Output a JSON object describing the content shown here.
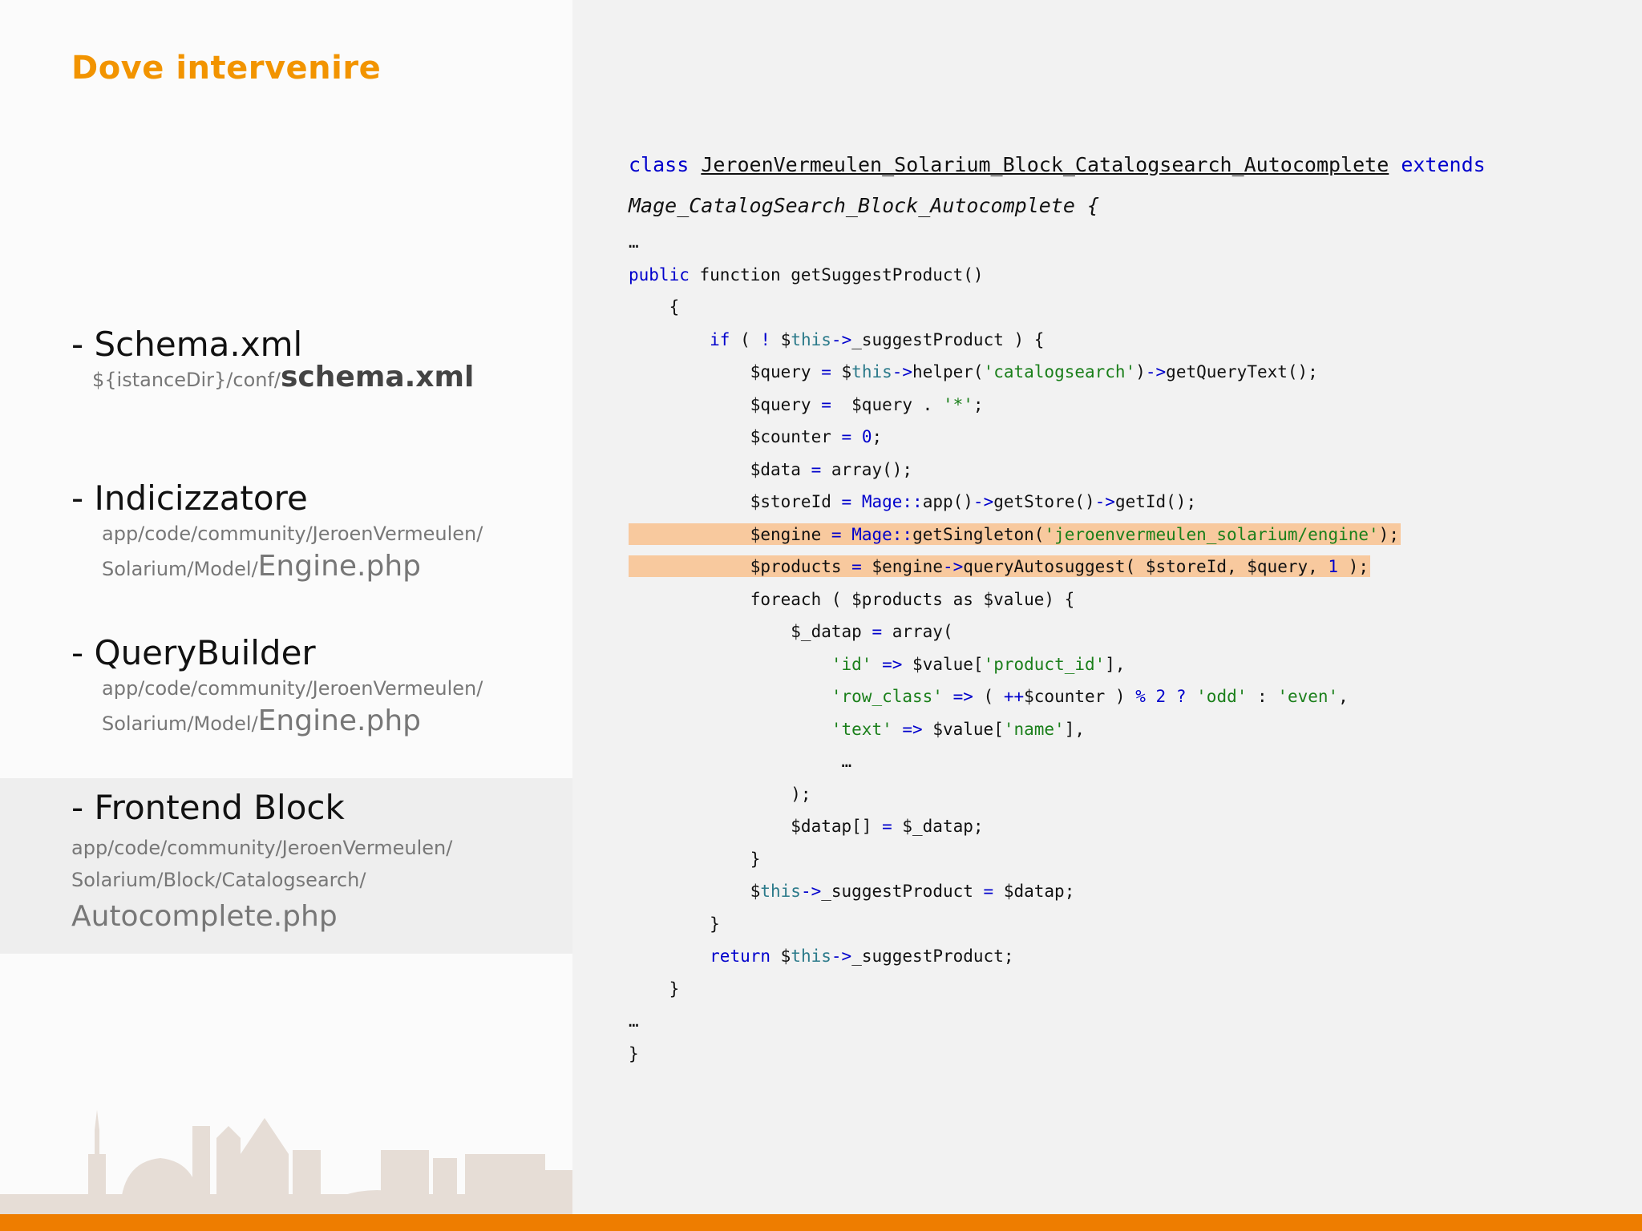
{
  "slide": {
    "title": "Dove intervenire",
    "items": [
      {
        "head": "- Schema.xml",
        "path_prefix": "${istanceDir}/conf/",
        "path_file": "schema.xml"
      },
      {
        "head": "- Indicizzatore",
        "path_line1": "app/code/community/JeroenVermeulen/",
        "path_line2_prefix": "Solarium/Model/",
        "path_file": "Engine.php"
      },
      {
        "head": "- QueryBuilder",
        "path_line1": "app/code/community/JeroenVermeulen/",
        "path_line2_prefix": "Solarium/Model/",
        "path_file": "Engine.php"
      },
      {
        "head": "- Frontend Block",
        "path_line1": "app/code/community/JeroenVermeulen/",
        "path_line2": "Solarium/Block/Catalogsearch/",
        "path_file": "Autocomplete.php"
      }
    ]
  },
  "code": {
    "class_kw": "class",
    "class_name": "JeroenVermeulen_Solarium_Block_Catalogsearch_Autocomplete",
    "extends_kw": "extends",
    "parent_class": "Mage_CatalogSearch_Block_Autocomplete {",
    "ellipsis": "…",
    "lines": [
      "public function getSuggestProduct()",
      "    {",
      "        if ( ! $this->_suggestProduct ) {",
      "            $query = $this->helper('catalogsearch')->getQueryText();",
      "            $query =  $query . '*';",
      "            $counter = 0;",
      "            $data = array();",
      "            $storeId = Mage::app()->getStore()->getId();",
      "            $engine = Mage::getSingleton('jeroenvermeulen_solarium/engine');",
      "            $products = $engine->queryAutosuggest( $storeId, $query, 1 );",
      "            foreach ( $products as $value) {",
      "                $_datap = array(",
      "                    'id' => $value['product_id'],",
      "                    'row_class' => ( ++$counter ) % 2 ? 'odd' : 'even',",
      "                    'text' => $value['name'],",
      "                     …",
      "                );",
      "                $datap[] = $_datap;",
      "            }",
      "            $this->_suggestProduct = $datap;",
      "        }",
      "        return $this->_suggestProduct;",
      "    }",
      "…",
      "}"
    ],
    "highlighted_lines": [
      8,
      9
    ],
    "colors": {
      "keyword": "#0000cc",
      "this": "#2b7a8a",
      "string": "#1a7f1a",
      "highlight": "#f8c99e"
    }
  },
  "colors": {
    "title": "#f29400",
    "bottom_bar": "#ee7d00"
  }
}
